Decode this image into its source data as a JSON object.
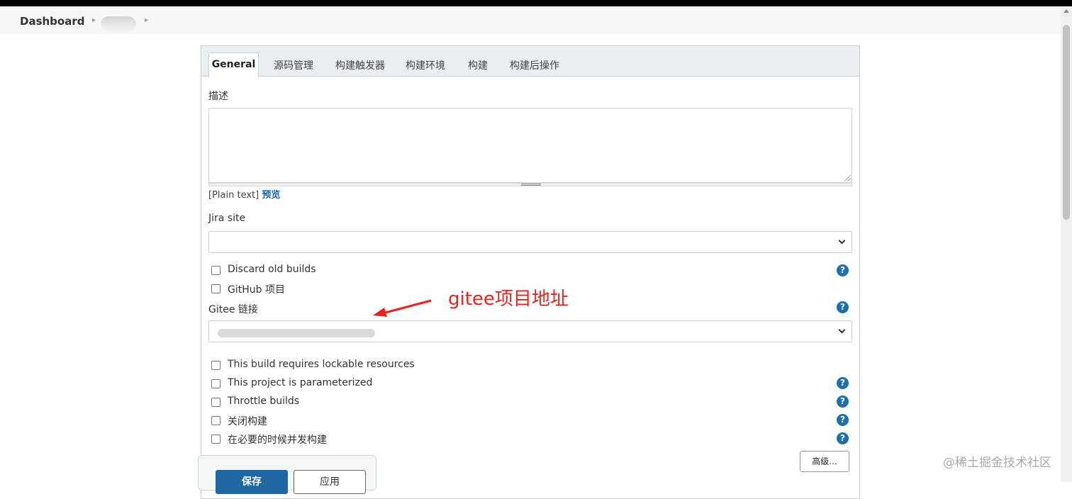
{
  "breadcrumb": {
    "items": [
      "Dashboard"
    ]
  },
  "tabs": [
    {
      "label": "General"
    },
    {
      "label": "源码管理"
    },
    {
      "label": "构建触发器"
    },
    {
      "label": "构建环境"
    },
    {
      "label": "构建"
    },
    {
      "label": "构建后操作"
    }
  ],
  "description": {
    "label": "描述",
    "value": "",
    "plain_text": "[Plain text]",
    "preview_link": "预览"
  },
  "jira_site": {
    "label": "Jira site",
    "selected": ""
  },
  "options_top": [
    {
      "label": "Discard old builds",
      "checked": false
    },
    {
      "label": "GitHub 项目",
      "checked": false
    }
  ],
  "gitee": {
    "label": "Gitee 链接"
  },
  "options_bottom": [
    {
      "label": "This build requires lockable resources",
      "checked": false
    },
    {
      "label": "This project is parameterized",
      "checked": false
    },
    {
      "label": "Throttle builds",
      "checked": false
    },
    {
      "label": "关闭构建",
      "checked": false
    },
    {
      "label": "在必要的时候并发构建",
      "checked": false
    }
  ],
  "help_icon_glyph": "?",
  "advanced_button": "高级...",
  "save_button": "保存",
  "apply_button": "应用",
  "annotation": "gitee项目地址",
  "watermark": "@稀土掘金技术社区",
  "colors": {
    "accent": "#1f66a3",
    "help": "#1e6fae",
    "annotation": "#e8231f"
  }
}
